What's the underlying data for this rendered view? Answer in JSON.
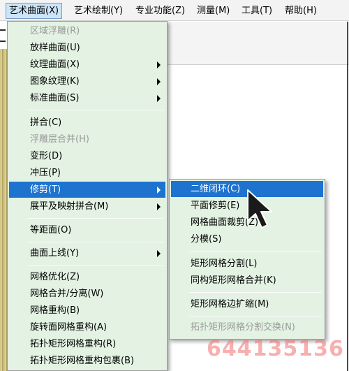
{
  "menubar": {
    "items": [
      {
        "label": "艺术曲面(X)"
      },
      {
        "label": "艺术绘制(Y)"
      },
      {
        "label": "专业功能(Z)"
      },
      {
        "label": "测量(M)"
      },
      {
        "label": "工具(T)"
      },
      {
        "label": "帮助(H)"
      }
    ]
  },
  "main_menu": {
    "items": [
      {
        "label": "区域浮雕(R)",
        "disabled": true
      },
      {
        "label": "放样曲面(U)"
      },
      {
        "label": "纹理曲面(X)",
        "submenu": true
      },
      {
        "label": "图象纹理(K)",
        "submenu": true
      },
      {
        "label": "标准曲面(S)",
        "submenu": true
      },
      {
        "label": "拼合(C)"
      },
      {
        "label": "浮雕层合并(H)",
        "disabled": true
      },
      {
        "label": "变形(D)"
      },
      {
        "label": "冲压(P)"
      },
      {
        "label": "修剪(T)",
        "submenu": true,
        "highlight": true
      },
      {
        "label": "展平及映射拼合(M)",
        "submenu": true
      },
      {
        "label": "等距面(O)"
      },
      {
        "label": "曲面上线(Y)",
        "submenu": true
      },
      {
        "label": "网格优化(Z)"
      },
      {
        "label": "网格合并/分离(W)"
      },
      {
        "label": "网格重构(B)"
      },
      {
        "label": "旋转面网格重构(A)"
      },
      {
        "label": "拓扑矩形网格重构(R)"
      },
      {
        "label": "拓扑矩形网格重构包裹(B)"
      }
    ]
  },
  "sub_menu": {
    "items": [
      {
        "label": "二维闭环(C)",
        "highlight": true
      },
      {
        "label": "平面修剪(E)"
      },
      {
        "label": "网格曲面裁剪(Z)"
      },
      {
        "label": "分模(S)"
      },
      {
        "label": "矩形网格分割(L)"
      },
      {
        "label": "同构矩形网格合并(K)"
      },
      {
        "label": "矩形网格边扩缩(M)"
      },
      {
        "label": "拓扑矩形网格分割交换(N)",
        "disabled": true
      }
    ]
  },
  "watermark": {
    "text": "644135136"
  },
  "colors": {
    "menu_bg": "#e3f2e3",
    "highlight": "#1e73cf",
    "disabled_text": "#9a9a9a",
    "menubar_active": "#cce4f7"
  },
  "icons": {
    "cursor": "arrow-cursor-icon"
  }
}
